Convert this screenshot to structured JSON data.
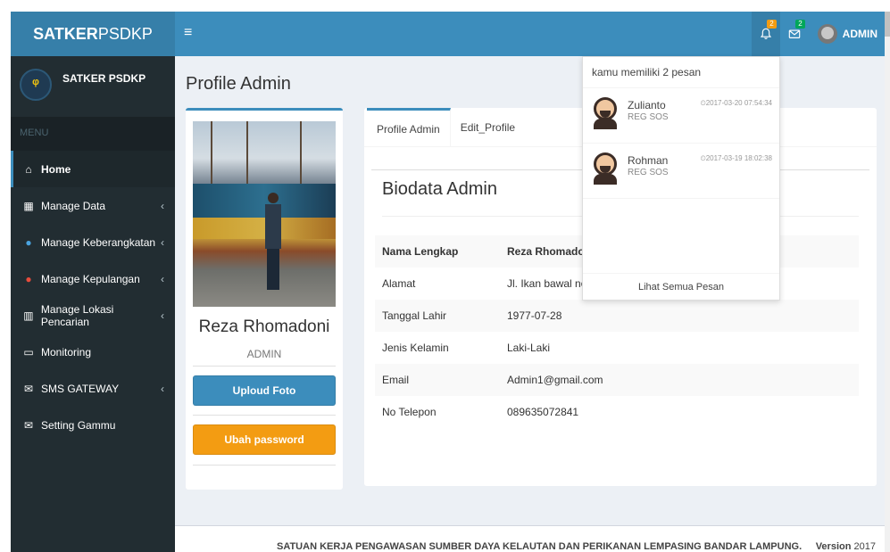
{
  "header": {
    "logo_bold": "SATKER",
    "logo_rest": "PSDKP",
    "notifications_count": "2",
    "messages_count": "2",
    "user_name": "ADMIN"
  },
  "sidebar": {
    "panel_name": "SATKER PSDKP",
    "menu_header": "MENU",
    "items": [
      {
        "label": "Home",
        "icon": "home-icon"
      },
      {
        "label": "Manage Data",
        "icon": "table-icon"
      },
      {
        "label": "Manage Keberangkatan",
        "icon": "user-icon"
      },
      {
        "label": "Manage Kepulangan",
        "icon": "user-icon"
      },
      {
        "label": "Manage Lokasi Pencarian",
        "icon": "map-icon"
      },
      {
        "label": "Monitoring",
        "icon": "monitor-icon"
      },
      {
        "label": "SMS GATEWAY",
        "icon": "envelope-outline-icon"
      },
      {
        "label": "Setting Gammu",
        "icon": "envelope-icon"
      }
    ]
  },
  "page": {
    "title": "Profile Admin"
  },
  "profile": {
    "name": "Reza Rhomadoni",
    "role": "ADMIN",
    "upload_label": "Uploud Foto",
    "password_label": "Ubah password"
  },
  "tabs": [
    {
      "label": "Profile Admin"
    },
    {
      "label": "Edit_Profile"
    }
  ],
  "biodata": {
    "title": "Biodata Admin",
    "rows": [
      {
        "label": "Nama Lengkap",
        "value": "Reza Rhomadoni"
      },
      {
        "label": "Alamat",
        "value": "Jl. Ikan bawal no."
      },
      {
        "label": "Tanggal Lahir",
        "value": "1977-07-28"
      },
      {
        "label": "Jenis Kelamin",
        "value": "Laki-Laki"
      },
      {
        "label": "Email",
        "value": "Admin1@gmail.com"
      },
      {
        "label": "No Telepon",
        "value": "089635072841"
      }
    ]
  },
  "messages": {
    "header": "kamu memiliki 2 pesan",
    "items": [
      {
        "name": "Zulianto",
        "sub": "REG SOS",
        "time": "⏲2017-03-20 07:54:34"
      },
      {
        "name": "Rohman",
        "sub": "REG SOS",
        "time": "⏲2017-03-19 18:02:38"
      }
    ],
    "footer": "Lihat Semua Pesan"
  },
  "footer": {
    "text": "SATUAN KERJA PENGAWASAN SUMBER DAYA KELAUTAN DAN PERIKANAN LEMPASING BANDAR LAMPUNG.",
    "version_label": "Version",
    "version_value": "2017"
  }
}
